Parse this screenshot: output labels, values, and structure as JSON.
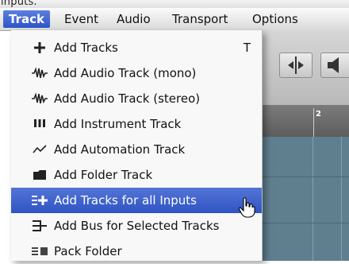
{
  "window": {
    "top_caption": "inputs."
  },
  "menubar": {
    "items": [
      "Track",
      "Event",
      "Audio",
      "Transport",
      "Options"
    ]
  },
  "ruler": {
    "marker": "2"
  },
  "track_menu": {
    "items": [
      {
        "label": "Add Tracks",
        "icon": "plus-icon",
        "shortcut": "T"
      },
      {
        "label": "Add Audio Track (mono)",
        "icon": "waveform-icon"
      },
      {
        "label": "Add Audio Track (stereo)",
        "icon": "waveform-icon"
      },
      {
        "label": "Add Instrument Track",
        "icon": "instrument-icon"
      },
      {
        "label": "Add Automation Track",
        "icon": "automation-icon"
      },
      {
        "label": "Add Folder Track",
        "icon": "folder-icon"
      },
      {
        "label": "Add Tracks for all Inputs",
        "icon": "tracks-inputs-icon",
        "highlighted": true
      },
      {
        "label": "Add Bus for Selected Tracks",
        "icon": "bus-icon"
      },
      {
        "label": "Pack Folder",
        "icon": "pack-folder-icon"
      }
    ]
  },
  "colors": {
    "highlight": "#3a5fcd",
    "menubar": "#e6e6e6",
    "track_area": "#5f7f8f"
  }
}
